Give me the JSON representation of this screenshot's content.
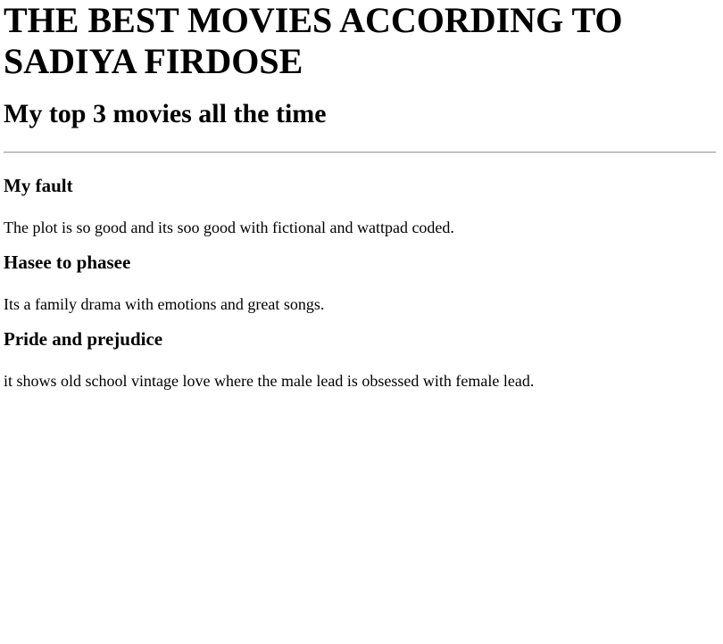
{
  "header": {
    "title": "THE BEST MOVIES ACCORDING TO SADIYA FIRDOSE",
    "subtitle": "My top 3 movies all the time"
  },
  "movies": [
    {
      "title": "My fault",
      "description": "The plot is so good and its soo good with fictional and wattpad coded."
    },
    {
      "title": "Hasee to phasee",
      "description": "Its a family drama with emotions and great songs."
    },
    {
      "title": "Pride and prejudice",
      "description": "it shows old school vintage love where the male lead is obsessed with female lead."
    }
  ]
}
